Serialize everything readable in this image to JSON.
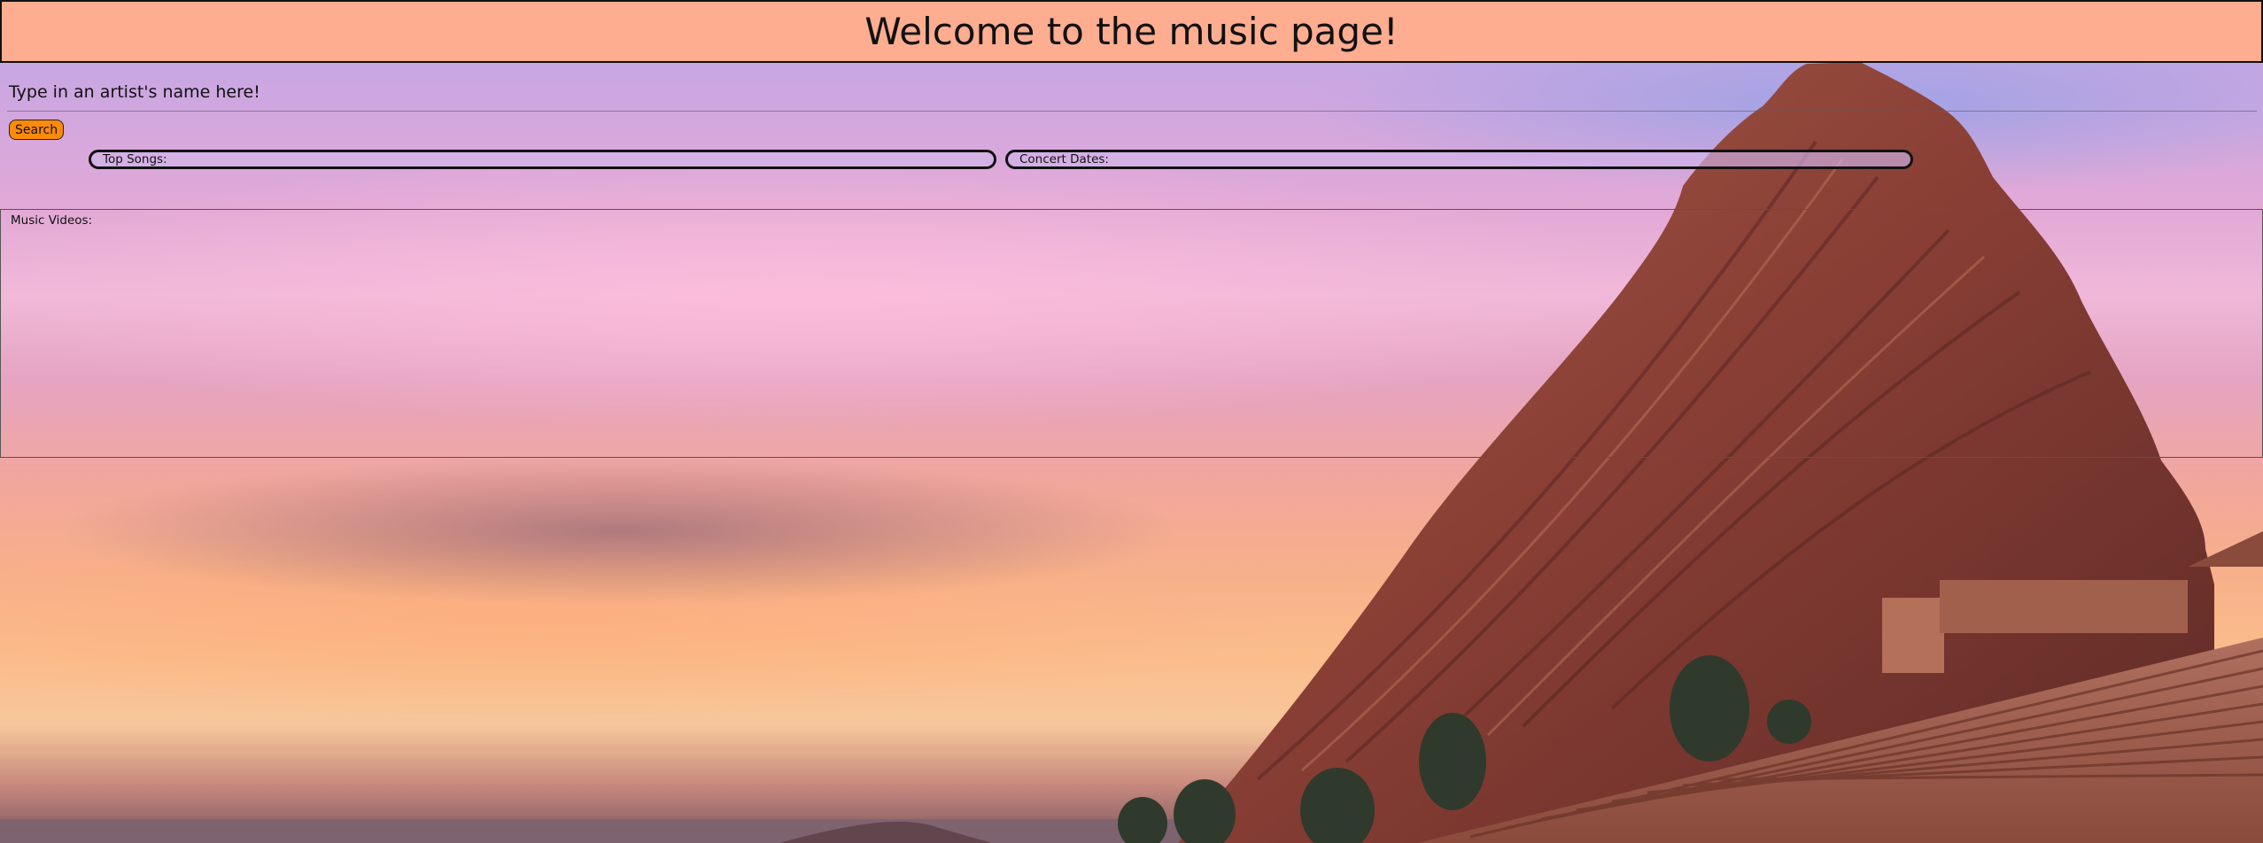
{
  "header": {
    "title": "Welcome to the music page!"
  },
  "search": {
    "prompt": "Type in an artist's name here!",
    "input_value": "",
    "button_label": "Search"
  },
  "results": {
    "top_songs_label": "Top Songs:",
    "concert_dates_label": "Concert Dates:",
    "music_videos_label": "Music Videos:"
  },
  "colors": {
    "header_bg": "#ffad91",
    "search_button_bg": "#ff8a0a"
  }
}
